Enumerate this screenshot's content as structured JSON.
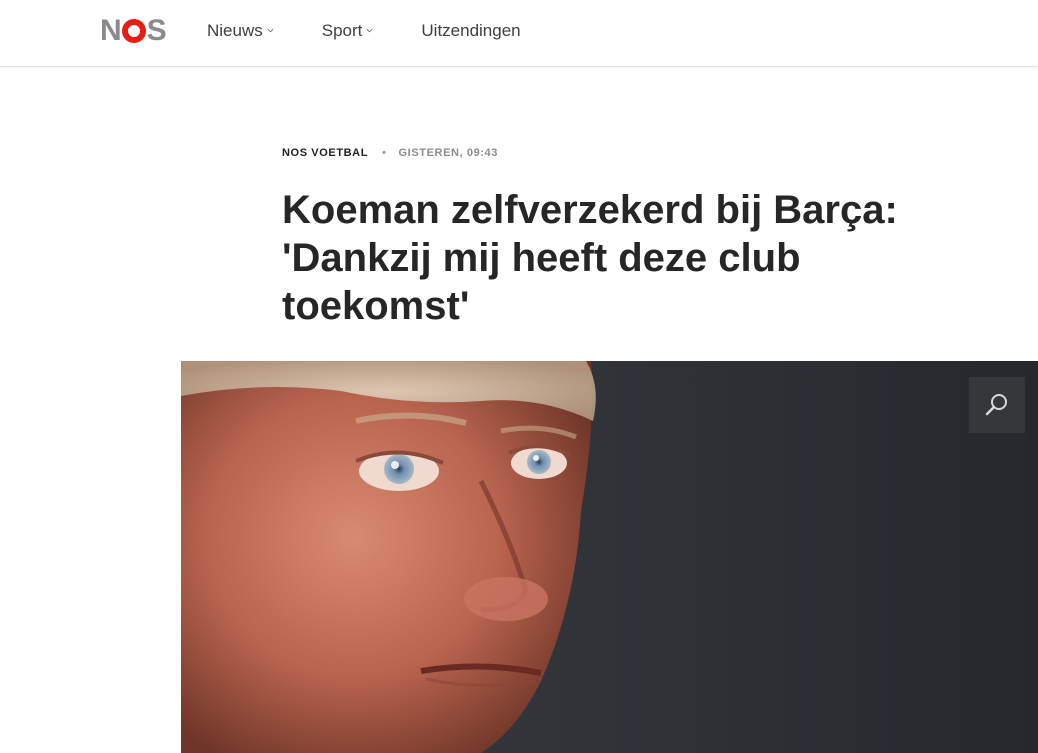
{
  "header": {
    "logo_text": "NOS",
    "nav": [
      {
        "label": "Nieuws",
        "has_dropdown": true
      },
      {
        "label": "Sport",
        "has_dropdown": true
      },
      {
        "label": "Uitzendingen",
        "has_dropdown": false
      }
    ]
  },
  "article": {
    "source": "NOS VOETBAL",
    "timestamp": "GISTEREN, 09:43",
    "title": "Koeman zelfverzekerd bij Barça: 'Dankzij mij heeft deze club toekomst'"
  },
  "hero": {
    "zoom_icon": "magnifier-icon"
  },
  "colors": {
    "brand_red": "#e61e14",
    "logo_grey": "#8a8a8a",
    "headline": "#262626"
  }
}
